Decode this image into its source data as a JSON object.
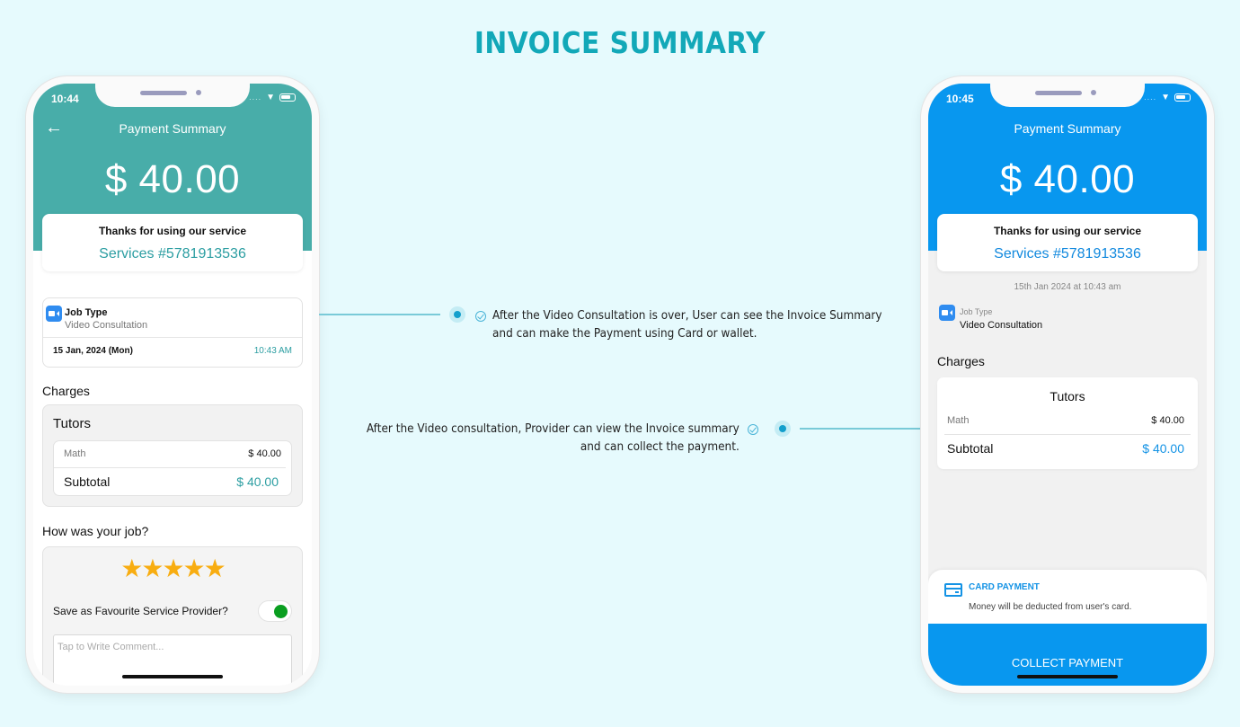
{
  "page": {
    "title": "INVOICE SUMMARY"
  },
  "colors": {
    "title": "#12a8b8",
    "user_theme": "#48ada9",
    "provider_theme": "#0897ef",
    "star": "#f8ad11",
    "toggle_on": "#0a9e20"
  },
  "user_screen": {
    "status": {
      "time": "10:44"
    },
    "header": {
      "back_icon": "arrow-left-icon",
      "title": "Payment Summary",
      "amount": "$ 40.00"
    },
    "thanks_card": {
      "text": "Thanks for using our service",
      "service_number": "Services #5781913536"
    },
    "job_card": {
      "icon": "video-camera-icon",
      "label": "Job Type",
      "value": "Video Consultation",
      "date": "15 Jan, 2024 (Mon)",
      "time": "10:43 AM"
    },
    "charges": {
      "label": "Charges",
      "category": "Tutors",
      "items": [
        {
          "name": "Math",
          "amount": "$ 40.00"
        }
      ],
      "subtotal_label": "Subtotal",
      "subtotal_value": "$ 40.00"
    },
    "rating": {
      "label": "How was your job?",
      "stars": 5,
      "max_stars": 5,
      "star_glyph": "★",
      "favourite_label": "Save as Favourite Service Provider?",
      "favourite_on": true,
      "comment_placeholder": "Tap to Write Comment..."
    }
  },
  "provider_screen": {
    "status": {
      "time": "10:45"
    },
    "header": {
      "title": "Payment Summary",
      "amount": "$ 40.00"
    },
    "thanks_card": {
      "text": "Thanks for using our service",
      "service_number": "Services #5781913536"
    },
    "date_stamp": "15th Jan 2024 at 10:43 am",
    "job": {
      "icon": "video-camera-icon",
      "label": "Job Type",
      "value": "Video Consultation"
    },
    "charges": {
      "label": "Charges",
      "category": "Tutors",
      "items": [
        {
          "name": "Math",
          "amount": "$ 40.00"
        }
      ],
      "subtotal_label": "Subtotal",
      "subtotal_value": "$ 40.00"
    },
    "payment": {
      "icon": "credit-card-icon",
      "title": "CARD PAYMENT",
      "description": "Money will be deducted from user's card."
    },
    "collect_button": "COLLECT PAYMENT"
  },
  "annotations": [
    {
      "line1": "After the Video Consultation is over, User can see the Invoice Summary",
      "line2": "and can make the Payment using Card or wallet."
    },
    {
      "line1": "After the Video consultation, Provider can view the Invoice summary",
      "line2": "and can collect the payment."
    }
  ]
}
